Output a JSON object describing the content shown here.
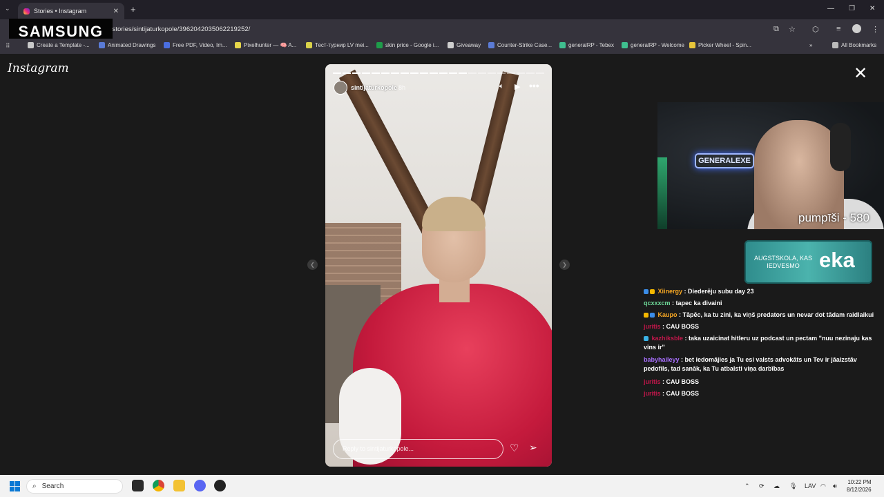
{
  "browser": {
    "tab_title": "Stories • Instagram",
    "tab_close": "✕",
    "new_tab": "+",
    "url": "/stories/sintijaturkopole/3962042035062219252/",
    "overlay_brand": "SAMSUNG",
    "bookmarks": [
      {
        "label": "Create a Template -...",
        "color": "#c9c9c9"
      },
      {
        "label": "Animated Drawings",
        "color": "#5a7bd6"
      },
      {
        "label": "Free PDF, Video, Im...",
        "color": "#4a6ee0"
      },
      {
        "label": "Pixelhunter — 🧠 A...",
        "color": "#e6d64a"
      },
      {
        "label": "Тест-турнир LV mei...",
        "color": "#d9d24a"
      },
      {
        "label": "skin price - Google i...",
        "color": "#1e9d4a"
      },
      {
        "label": "Giveaway",
        "color": "#cfcfcf"
      },
      {
        "label": "Counter-Strike Case...",
        "color": "#5b7bd6"
      },
      {
        "label": "generalRP - Tebex",
        "color": "#3fbf8f"
      },
      {
        "label": "generalRP - Welcome",
        "color": "#3fbf8f"
      },
      {
        "label": "Picker Wheel - Spin...",
        "color": "#e8c63a"
      }
    ],
    "all_bookmarks": "All Bookmarks",
    "more_bookmarks": "»"
  },
  "instagram": {
    "logo": "Instagram",
    "close": "✕",
    "story": {
      "username": "sintijaturkopole",
      "time": "8h",
      "reply_placeholder": "Reply to sintijaturkopole...",
      "progress_total": 22,
      "progress_done": 14
    }
  },
  "stream": {
    "neon_sign": "GENERALEXE",
    "cam_label": "pumpīši - 580",
    "banner_text": "AUGSTSKOLA, KAS IEDVESMO",
    "banner_logo": "eka"
  },
  "chat": [
    {
      "user": "Xiinergy",
      "color": "#f5a623",
      "text": " : Diederēju subu day 23",
      "badges": [
        "#3b8de8",
        "#f5b800"
      ]
    },
    {
      "user": "qcxxxcm",
      "color": "#6fdc9a",
      "text": " : tapec ka divaini",
      "badges": []
    },
    {
      "user": "Kaupo",
      "color": "#f5a623",
      "text": " : Tāpēc, ka tu zini, ka viņš predators un nevar dot tādam raidlaikui",
      "badges": [
        "#f5b800",
        "#3b8de8"
      ]
    },
    {
      "user": "juritis",
      "color": "#c0174a",
      "text": " : CAU BOSS",
      "badges": []
    },
    {
      "user": "kazhiksble",
      "color": "#c0174a",
      "text": " : taka uzaicinat hitleru uz podcast un pectam \"nuu nezinaju kas vins ir\"",
      "badges": [
        "#3bb4e8"
      ]
    },
    {
      "user": "babyhaileyy",
      "color": "#a970ff",
      "text": " : bet iedomājies ja Tu esi valsts advokāts un Tev ir jāaizstāv pedofils, tad sanāk, ka Tu atbalsti viņa darbības",
      "badges": []
    },
    {
      "user": "juritis",
      "color": "#c0174a",
      "text": " : CAU BOSS",
      "badges": []
    },
    {
      "user": "juritis",
      "color": "#c0174a",
      "text": " : CAU BOSS",
      "badges": []
    }
  ],
  "taskbar": {
    "search_label": "Search",
    "lang": "LAV",
    "time": "10:22 PM",
    "date": "8/12/2026"
  }
}
